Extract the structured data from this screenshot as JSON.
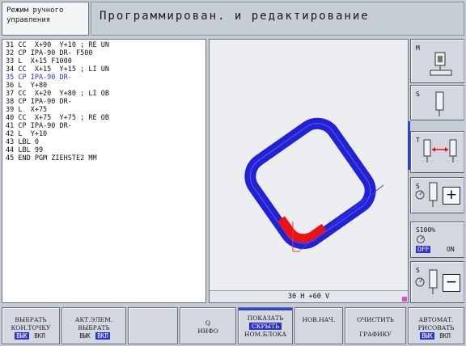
{
  "header": {
    "mode_line1": "Режим ручного",
    "mode_line2": "управления",
    "title": "Программирован. и редактирование"
  },
  "program": {
    "lines": [
      "31 CC  X+90  Y+10 ; RE UN",
      "32 CP IPA-90 DR- F500",
      "33 L  X+15 F1000",
      "34 CC  X+15  Y+15 ; LI UN",
      "35 CP IPA-90 DR-",
      "36 L  Y+80",
      "37 CC  X+20  Y+80 ; LI OB",
      "38 CP IPA-90 DR-",
      "39 L  X+75",
      "40 CC  X+75  Y+75 ; RE OB",
      "41 CP IPA-90 DR-",
      "42 L  Y+10",
      "43 LBL 0",
      "44 LBL 99",
      "45 END PGM ZIEHSTE2 MM"
    ],
    "active_index": 4
  },
  "graphics": {
    "readout": "30 H +60 V",
    "colors": {
      "path": "#2222d4",
      "highlight": "#ee1111",
      "line": "#3a3aff"
    }
  },
  "side_buttons": {
    "m_label": "M",
    "s_label": "S",
    "t_label": "T",
    "s2_label": "S",
    "plus_label": "+",
    "override_label": "S100%",
    "override_off": "OFF",
    "override_on": "ON",
    "s3_label": "S",
    "minus_label": "−"
  },
  "softkeys": {
    "k1": {
      "line1": "ВЫБРАТЬ",
      "line2": "КОН.ТОЧКУ",
      "off": "ВЫК",
      "on": "ВКЛ"
    },
    "k2": {
      "line1": "АКТ.ЭЛЕМ.",
      "line2": "ВЫБРАТЬ",
      "off": "ВЫК",
      "on": "ВКЛ"
    },
    "k3": {
      "line1": "",
      "line2": ""
    },
    "k4": {
      "line1": "Q",
      "line2": "ИНФО"
    },
    "k5": {
      "line1": "ПОКАЗАТЬ",
      "line2": "СКРЫТЬ",
      "line3": "НОМ.БЛОКА"
    },
    "k6": {
      "line1": "НОВ.НАЧ."
    },
    "k7": {
      "line1": "ОЧИСТИТЬ",
      "line2": "ГРАФИКУ"
    },
    "k8": {
      "line1": "АВТОМАТ.",
      "line2": "РИСОВАТЬ",
      "off": "ВЫК",
      "on": "ВКЛ"
    }
  }
}
